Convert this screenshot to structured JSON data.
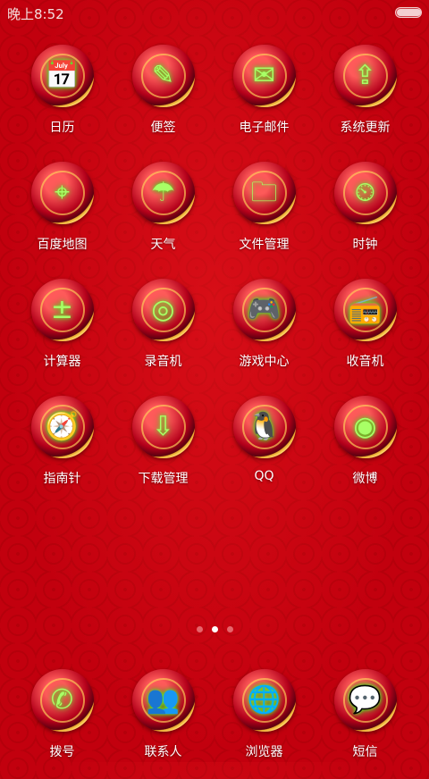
{
  "status_bar": {
    "time": "晚上8:52",
    "battery_level": 0.95
  },
  "apps": [
    {
      "label": "日历",
      "icon": "calendar-icon",
      "glyph": "📅"
    },
    {
      "label": "便签",
      "icon": "notes-icon",
      "glyph": "✎"
    },
    {
      "label": "电子邮件",
      "icon": "mail-icon",
      "glyph": "✉"
    },
    {
      "label": "系统更新",
      "icon": "upload-icon",
      "glyph": "⇪"
    },
    {
      "label": "百度地图",
      "icon": "map-pin-icon",
      "glyph": "⌖"
    },
    {
      "label": "天气",
      "icon": "umbrella-icon",
      "glyph": "☂"
    },
    {
      "label": "文件管理",
      "icon": "folder-icon",
      "glyph": "🗀"
    },
    {
      "label": "时钟",
      "icon": "clock-icon",
      "glyph": "⏲"
    },
    {
      "label": "计算器",
      "icon": "calculator-icon",
      "glyph": "±"
    },
    {
      "label": "录音机",
      "icon": "recorder-icon",
      "glyph": "◎"
    },
    {
      "label": "游戏中心",
      "icon": "gamepad-icon",
      "glyph": "🎮"
    },
    {
      "label": "收音机",
      "icon": "radio-icon",
      "glyph": "📻"
    },
    {
      "label": "指南针",
      "icon": "compass-icon",
      "glyph": "🧭"
    },
    {
      "label": "下载管理",
      "icon": "download-icon",
      "glyph": "⇩"
    },
    {
      "label": "QQ",
      "icon": "qq-penguin-icon",
      "glyph": "🐧"
    },
    {
      "label": "微博",
      "icon": "weibo-icon",
      "glyph": "◉"
    }
  ],
  "page_indicator": {
    "count": 3,
    "active": 1
  },
  "dock": [
    {
      "label": "拨号",
      "icon": "phone-icon",
      "glyph": "✆"
    },
    {
      "label": "联系人",
      "icon": "contacts-icon",
      "glyph": "👥"
    },
    {
      "label": "浏览器",
      "icon": "globe-icon",
      "glyph": "🌐"
    },
    {
      "label": "短信",
      "icon": "message-icon",
      "glyph": "💬"
    }
  ]
}
